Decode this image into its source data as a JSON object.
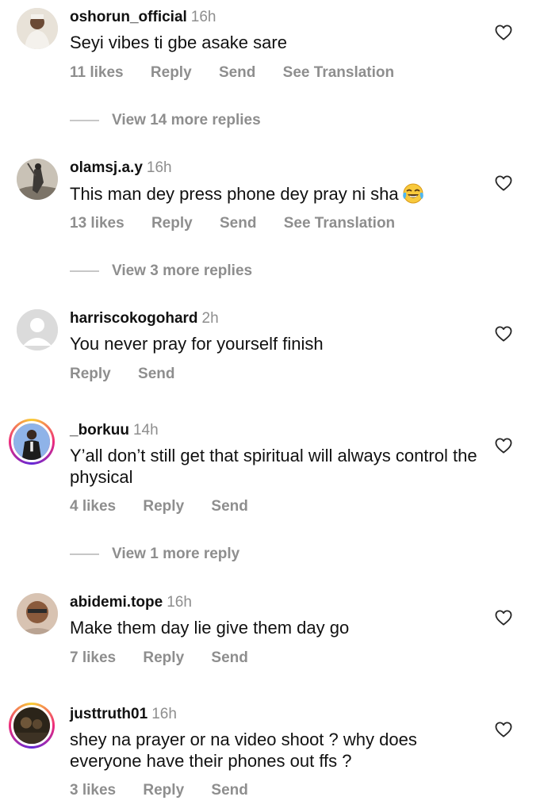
{
  "comments": [
    {
      "username": "oshorun_official",
      "time": "16h",
      "text": "Seyi vibes ti gbe asake sare",
      "likes": "11 likes",
      "reply": "Reply",
      "send": "Send",
      "translate": "See Translation",
      "more_replies": "View 14 more replies"
    },
    {
      "username": "olamsj.a.y",
      "time": "16h",
      "text": "This man dey press phone dey pray ni sha",
      "emoji": "face-with-tears-of-joy",
      "likes": "13 likes",
      "reply": "Reply",
      "send": "Send",
      "translate": "See Translation",
      "more_replies": "View 3 more replies"
    },
    {
      "username": "harriscokogohard",
      "time": "2h",
      "text": "You never pray for yourself finish",
      "reply": "Reply",
      "send": "Send"
    },
    {
      "username": "_borkuu",
      "time": "14h",
      "text": "Y’all don’t still get that spiritual will always control the physical",
      "likes": "4 likes",
      "reply": "Reply",
      "send": "Send",
      "more_replies": "View 1 more reply"
    },
    {
      "username": "abidemi.tope",
      "time": "16h",
      "text": "Make them day lie give them day go",
      "likes": "7 likes",
      "reply": "Reply",
      "send": "Send"
    },
    {
      "username": "justtruth01",
      "time": "16h",
      "text": "shey na prayer or na video shoot ? why does everyone have their phones out ffs ?",
      "likes": "3 likes",
      "reply": "Reply",
      "send": "Send"
    }
  ],
  "icons": {
    "like": "heart-outline-icon"
  },
  "colors": {
    "secondary_text": "#8e8e8e",
    "primary_text": "#111111",
    "divider": "#c7c7c7"
  }
}
